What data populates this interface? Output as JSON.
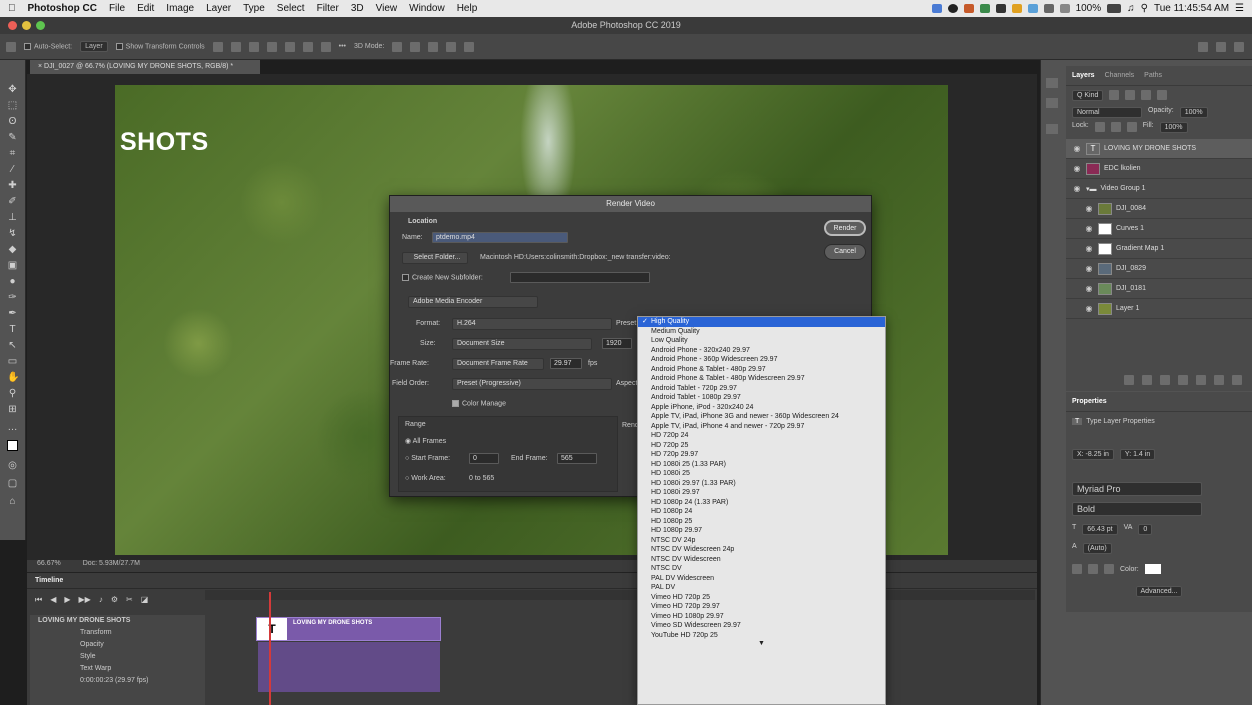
{
  "menubar": {
    "apple": "",
    "app_name": "Photoshop CC",
    "items": [
      "File",
      "Edit",
      "Image",
      "Layer",
      "Type",
      "Select",
      "Filter",
      "3D",
      "View",
      "Window",
      "Help"
    ],
    "battery": "100%",
    "clock": "Tue 11:45:54 AM"
  },
  "window": {
    "title": "Adobe Photoshop CC 2019"
  },
  "options_bar": {
    "auto_select": "Auto-Select:",
    "layer_select": "Layer",
    "show_transform": "Show Transform Controls",
    "mode_3d": "3D Mode:"
  },
  "document": {
    "tab_title": "DJI_0027 @ 66.7% (LOVING MY DRONE SHOTS, RGB/8) *"
  },
  "canvas": {
    "overlay_text": "SHOTS"
  },
  "status": {
    "zoom": "66.67%",
    "doc_size": "Doc: 5.93M/27.7M"
  },
  "layers_panel": {
    "tabs": [
      "Layers",
      "Channels",
      "Paths"
    ],
    "kind": "Q Kind",
    "blend": "Normal",
    "opacity_label": "Opacity:",
    "opacity": "100%",
    "lock_label": "Lock:",
    "fill_label": "Fill:",
    "fill": "100%",
    "layers": [
      {
        "name": "LOVING MY DRONE SHOTS",
        "kind": "T",
        "selected": true
      },
      {
        "name": "EDC lkolien",
        "kind": "img"
      },
      {
        "name": "Video Group 1",
        "kind": "folder"
      },
      {
        "name": "DJI_0084",
        "kind": "img"
      },
      {
        "name": "Curves 1",
        "kind": "adj"
      },
      {
        "name": "Gradient Map 1",
        "kind": "adj"
      },
      {
        "name": "DJI_0829",
        "kind": "img"
      },
      {
        "name": "DJI_0181",
        "kind": "img"
      },
      {
        "name": "Layer 1",
        "kind": "img"
      }
    ]
  },
  "properties_panel": {
    "title": "Properties",
    "subtitle": "Type Layer Properties",
    "x": "X: -8.25 in",
    "y": "Y: 1.4 in",
    "font": "Myriad Pro",
    "style": "Bold",
    "size": "66.43 pt",
    "tracking": "0",
    "leading": "(Auto)",
    "color_label": "Color:",
    "advanced": "Advanced..."
  },
  "timeline": {
    "title": "Timeline",
    "track_name": "LOVING MY DRONE SHOTS",
    "rows": [
      "Transform",
      "Opacity",
      "Style",
      "Text Warp"
    ],
    "clip_label": "LOVING MY DRONE SHOTS",
    "timecode": "0:00:00:23",
    "fps": "(29.97 fps)"
  },
  "render_dialog": {
    "title": "Render Video",
    "location_label": "Location",
    "name_label": "Name:",
    "name_value": "ptdemo.mp4",
    "select_folder": "Select Folder...",
    "folder_path": "Macintosh HD:Users:colinsmith:Dropbox:_new transfer:video:",
    "create_subfolder": "Create New Subfolder:",
    "encoder": "Adobe Media Encoder",
    "format_label": "Format:",
    "format_value": "H.264",
    "preset_label": "Preset:",
    "size_label": "Size:",
    "size_value": "Document Size",
    "size_w": "1920",
    "frame_rate_label": "Frame Rate:",
    "frame_rate_value": "Document Frame Rate",
    "frame_rate_num": "29.97",
    "fps": "fps",
    "field_order_label": "Field Order:",
    "field_order_value": "Preset (Progressive)",
    "aspect_label": "Aspect:",
    "color_manage": "Color Manage",
    "range_label": "Range",
    "all_frames": "All Frames",
    "start_frame_label": "Start Frame:",
    "start_frame": "0",
    "end_frame_label": "End Frame:",
    "end_frame": "565",
    "work_area_label": "Work Area:",
    "work_area": "0 to 565",
    "render_opts_label": "Render Options",
    "render_btn": "Render",
    "cancel_btn": "Cancel"
  },
  "preset_menu": {
    "selected": "High Quality",
    "items": [
      "High Quality",
      "Medium Quality",
      "Low Quality",
      "Android Phone - 320x240 29.97",
      "Android Phone - 360p Widescreen 29.97",
      "Android Phone & Tablet - 480p 29.97",
      "Android Phone & Tablet - 480p Widescreen 29.97",
      "Android Tablet - 720p 29.97",
      "Android Tablet - 1080p 29.97",
      "Apple iPhone, iPod - 320x240 24",
      "Apple TV, iPad, iPhone 3G and newer - 360p Widescreen 24",
      "Apple TV, iPad, iPhone 4 and newer - 720p 29.97",
      "HD 720p 24",
      "HD 720p 25",
      "HD 720p 29.97",
      "HD 1080i 25 (1.33 PAR)",
      "HD 1080i 25",
      "HD 1080i 29.97 (1.33 PAR)",
      "HD 1080i 29.97",
      "HD 1080p 24 (1.33 PAR)",
      "HD 1080p 24",
      "HD 1080p 25",
      "HD 1080p 29.97",
      "NTSC DV 24p",
      "NTSC DV Widescreen 24p",
      "NTSC DV Widescreen",
      "NTSC DV",
      "PAL DV Widescreen",
      "PAL DV",
      "Vimeo HD 720p 25",
      "Vimeo HD 720p 29.97",
      "Vimeo HD 1080p 29.97",
      "Vimeo SD Widescreen 29.97",
      "YouTube HD 720p 25"
    ]
  },
  "colors": {
    "menu_highlight": "#2a64d6",
    "clip_purple": "#7a5aaa",
    "playhead": "#d43a3a"
  }
}
